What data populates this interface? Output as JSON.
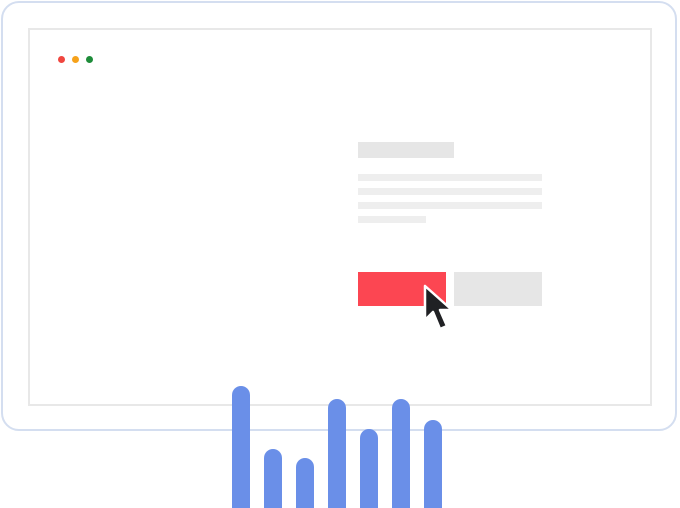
{
  "colors": {
    "frame_border": "#d4def0",
    "screen_border": "#e8e8e8",
    "dot_red": "#f0463f",
    "dot_yellow": "#f6a21b",
    "dot_green": "#1e8c3a",
    "skeleton": "#eeeeee",
    "primary_button": "#fc4652",
    "secondary_button": "#e6e6e6",
    "cursor_fill": "#202124",
    "cursor_stroke": "#ffffff",
    "bar": "#6a8fe8"
  },
  "icons": {
    "cursor": "mouse-pointer-icon",
    "window_dots": [
      "close-dot",
      "minimize-dot",
      "maximize-dot"
    ]
  },
  "chart_data": {
    "type": "bar",
    "values": [
      122,
      59,
      50,
      109,
      79,
      109,
      88
    ],
    "ylim": [
      0,
      122
    ],
    "grid": false
  }
}
